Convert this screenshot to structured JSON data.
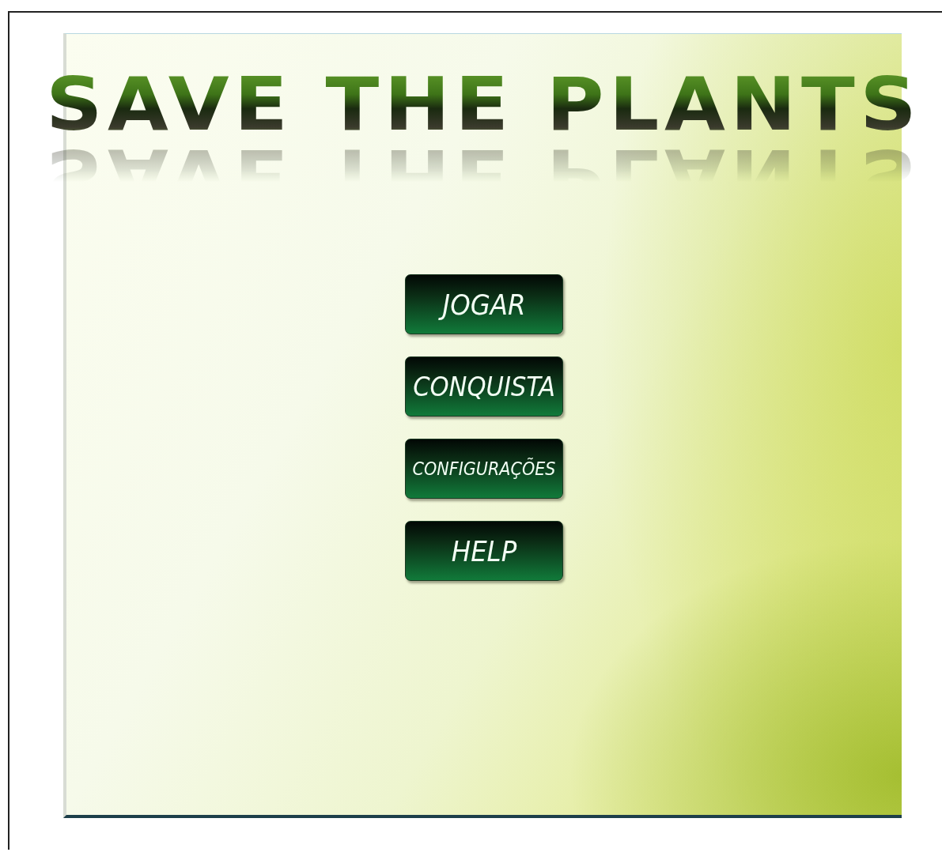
{
  "title": "SAVE THE PLANTS",
  "menu": [
    "JOGAR",
    "CONQUISTA",
    "CONFIGURAÇÕES",
    "HELP"
  ]
}
